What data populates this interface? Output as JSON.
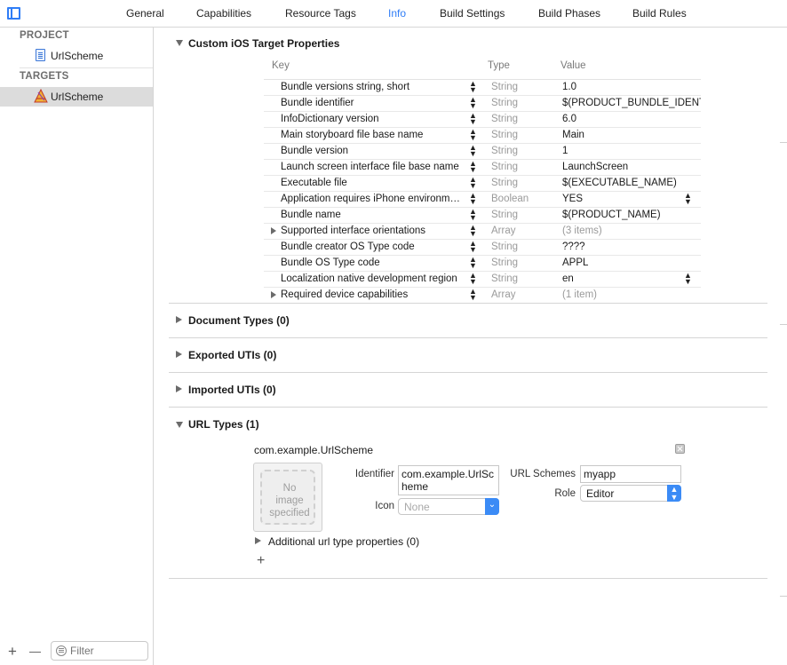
{
  "tabs": [
    {
      "label": "General"
    },
    {
      "label": "Capabilities"
    },
    {
      "label": "Resource Tags"
    },
    {
      "label": "Info"
    },
    {
      "label": "Build Settings"
    },
    {
      "label": "Build Phases"
    },
    {
      "label": "Build Rules"
    }
  ],
  "active_tab": "Info",
  "sidebar": {
    "project_header": "PROJECT",
    "project_item": "UrlScheme",
    "targets_header": "TARGETS",
    "target_item": "UrlScheme",
    "add_symbol": "+",
    "remove_symbol": "—",
    "filter_placeholder": "Filter"
  },
  "sections": {
    "custom_props": "Custom iOS Target Properties",
    "document_types": "Document Types (0)",
    "exported_utis": "Exported UTIs (0)",
    "imported_utis": "Imported UTIs (0)",
    "url_types": "URL Types (1)"
  },
  "table": {
    "headers": {
      "key": "Key",
      "type": "Type",
      "value": "Value"
    },
    "rows": [
      {
        "key": "Bundle versions string, short",
        "type": "String",
        "value": "1.0"
      },
      {
        "key": "Bundle identifier",
        "type": "String",
        "value": "$(PRODUCT_BUNDLE_IDENTI"
      },
      {
        "key": "InfoDictionary version",
        "type": "String",
        "value": "6.0"
      },
      {
        "key": "Main storyboard file base name",
        "type": "String",
        "value": "Main"
      },
      {
        "key": "Bundle version",
        "type": "String",
        "value": "1"
      },
      {
        "key": "Launch screen interface file base name",
        "type": "String",
        "value": "LaunchScreen"
      },
      {
        "key": "Executable file",
        "type": "String",
        "value": "$(EXECUTABLE_NAME)"
      },
      {
        "key": "Application requires iPhone environm…",
        "type": "Boolean",
        "value": "YES"
      },
      {
        "key": "Bundle name",
        "type": "String",
        "value": "$(PRODUCT_NAME)"
      },
      {
        "key": "Supported interface orientations",
        "type": "Array",
        "value": "(3 items)"
      },
      {
        "key": "Bundle creator OS Type code",
        "type": "String",
        "value": "????"
      },
      {
        "key": "Bundle OS Type code",
        "type": "String",
        "value": "APPL"
      },
      {
        "key": "Localization native development region",
        "type": "String",
        "value": "en"
      },
      {
        "key": "Required device capabilities",
        "type": "Array",
        "value": "(1 item)"
      }
    ]
  },
  "url_type": {
    "name": "com.example.UrlScheme",
    "image_placeholder_1": "No",
    "image_placeholder_2": "image",
    "image_placeholder_3": "specified",
    "identifier_label": "Identifier",
    "identifier_value_1": "com.example.UrlSc",
    "identifier_value_2": "heme",
    "icon_label": "Icon",
    "icon_placeholder": "None",
    "schemes_label": "URL Schemes",
    "schemes_value": "myapp",
    "role_label": "Role",
    "role_value": "Editor",
    "additional": "Additional url type properties (0)",
    "add_symbol": "+"
  },
  "colors": {
    "accent": "#2f7df6",
    "popup_button": "#3b8bf6",
    "selection": "#dcdcdc"
  }
}
